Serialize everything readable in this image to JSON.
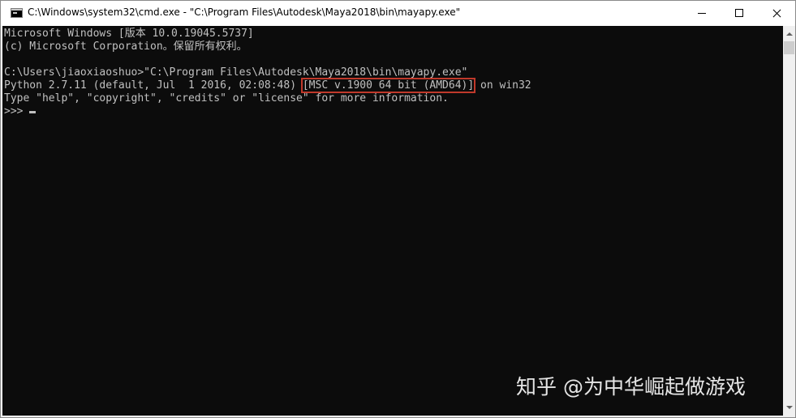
{
  "window": {
    "title": "C:\\Windows\\system32\\cmd.exe - \"C:\\Program Files\\Autodesk\\Maya2018\\bin\\mayapy.exe\"",
    "icon": "cmd-icon"
  },
  "console": {
    "background": "#0c0c0c",
    "foreground": "#c0c0c0",
    "lines": [
      "Microsoft Windows [版本 10.0.19045.5737]",
      "(c) Microsoft Corporation。保留所有权利。",
      "",
      "C:\\Users\\jiaoxiaoshuo>\"C:\\Program Files\\Autodesk\\Maya2018\\bin\\mayapy.exe\"",
      "Python 2.7.11 (default, Jul  1 2016, 02:08:48) [MSC v.1900 64 bit (AMD64)] on win32",
      "Type \"help\", \"copyright\", \"credits\" or \"license\" for more information.",
      ">>>"
    ],
    "python_line": {
      "before": "Python 2.7.11 (default, Jul  1 2016, 02:08:48) ",
      "highlight": "[MSC v.1900 64 bit (AMD64)]",
      "after": " on win32"
    },
    "highlight_color": "#c0392b"
  },
  "watermark": "知乎 @为中华崛起做游戏"
}
